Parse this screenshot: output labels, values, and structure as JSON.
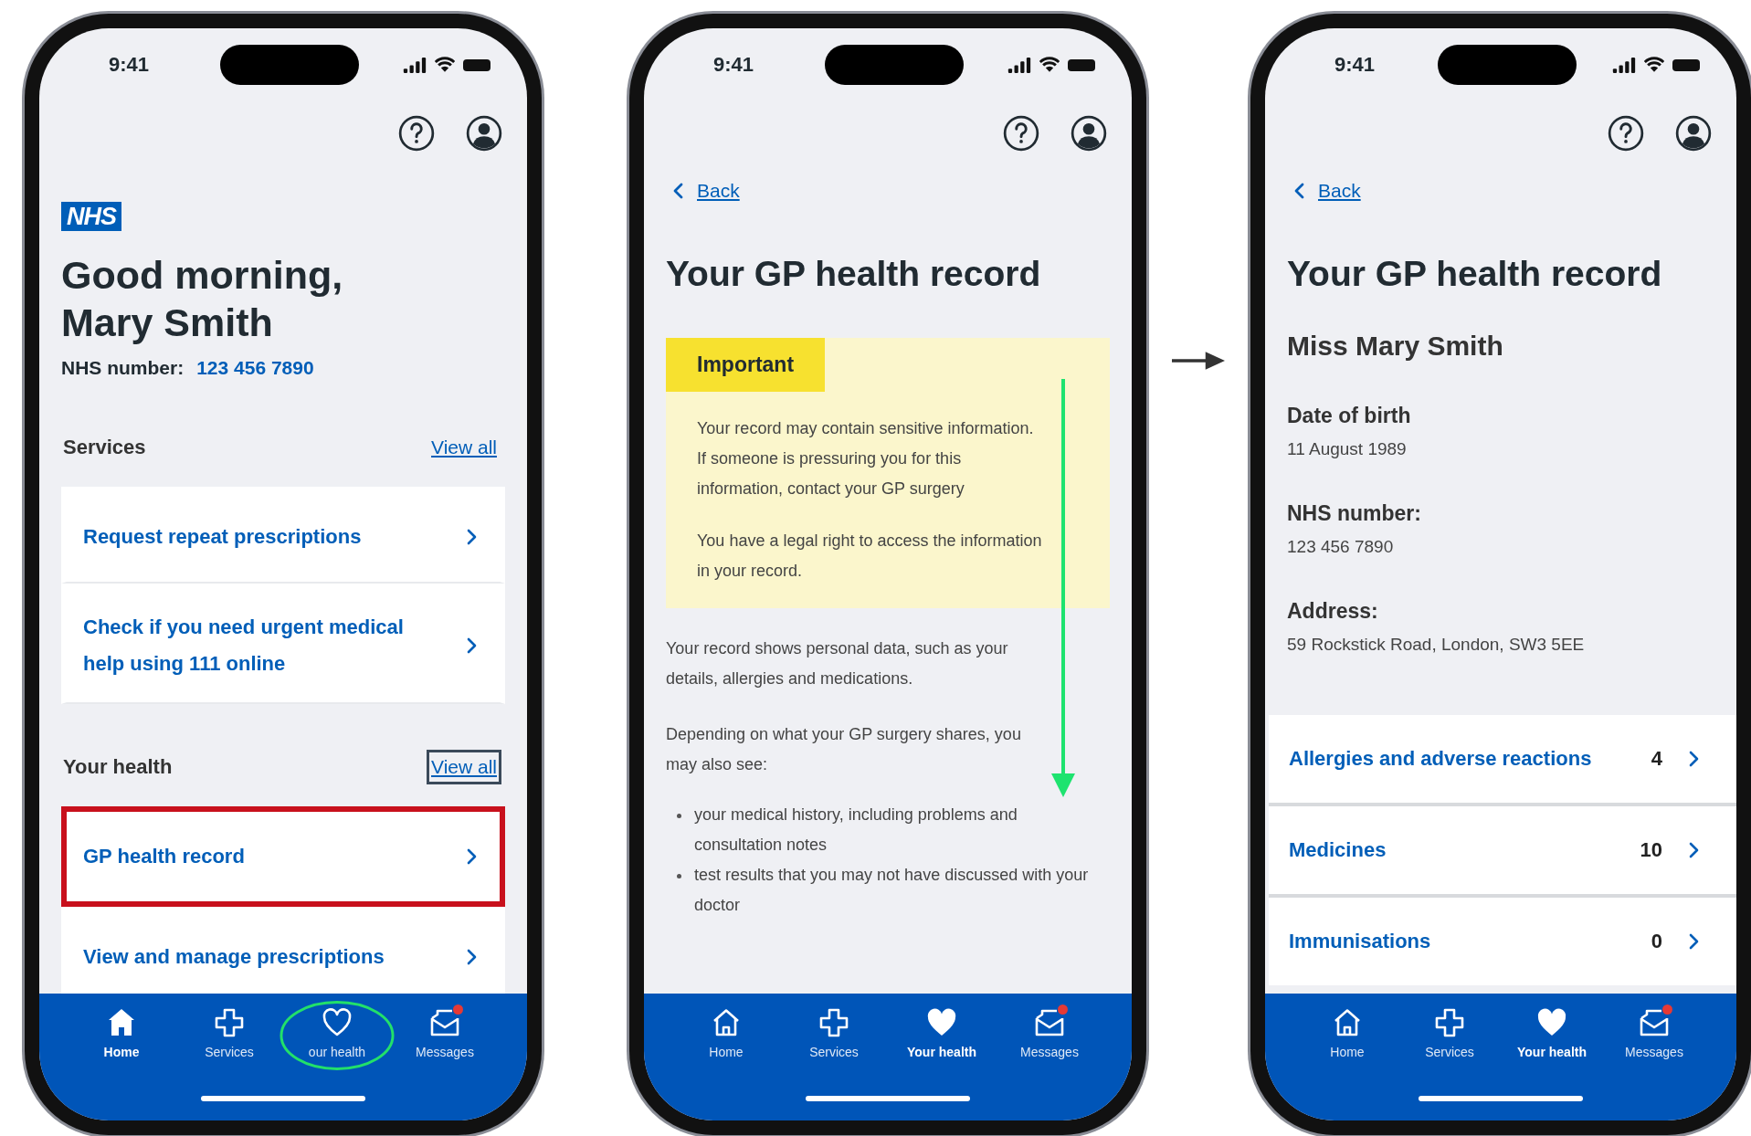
{
  "screens": [
    {
      "kind": "home",
      "time": "9:41",
      "logo": "NHS",
      "greeting": "Good morning, Mary Smith",
      "nhs_number_label": "NHS number:",
      "nhs_number": "123 456 7890",
      "sections": [
        {
          "title": "Services",
          "link": {
            "label": "View all",
            "boxed": false
          },
          "items": [
            {
              "label": "Request repeat prescriptions",
              "highlighted": false
            },
            {
              "label": "Check if you need urgent medical help using 111 online",
              "highlighted": false
            }
          ]
        },
        {
          "title": "Your health",
          "link": {
            "label": "View all",
            "boxed": true
          },
          "items": [
            {
              "label": "GP health record",
              "highlighted": true
            },
            {
              "label": "View and manage prescriptions",
              "highlighted": false
            }
          ]
        }
      ],
      "tabs": [
        {
          "label": "Home",
          "selected": true,
          "circled": false,
          "unread": false
        },
        {
          "label": "Services",
          "selected": false,
          "circled": false,
          "unread": false
        },
        {
          "label": "our health",
          "selected": false,
          "circled": true,
          "unread": false
        },
        {
          "label": "Messages",
          "selected": false,
          "circled": false,
          "unread": true
        }
      ],
      "scroll_arrow": false,
      "arrow_to_next": false
    },
    {
      "kind": "info",
      "time": "9:41",
      "back": "Back",
      "title": "Your GP health record",
      "callout": {
        "label": "Important",
        "paragraphs": [
          "Your record may contain sensitive information. If someone is pressuring you for this information, contact your GP surgery",
          "You have a legal right to access the information in your record."
        ]
      },
      "paragraphs": [
        "Your record shows personal data, such as your details, allergies and medications.",
        "Depending on what your GP surgery shares, you may also see:"
      ],
      "bullets": [
        "your medical history, including problems and consultation notes",
        "test results that you may not have discussed with your doctor"
      ],
      "tabs": [
        {
          "label": "Home",
          "selected": false,
          "circled": false,
          "unread": false
        },
        {
          "label": "Services",
          "selected": false,
          "circled": false,
          "unread": false
        },
        {
          "label": "Your health",
          "selected": true,
          "circled": false,
          "unread": false
        },
        {
          "label": "Messages",
          "selected": false,
          "circled": false,
          "unread": true
        }
      ],
      "scroll_arrow": true,
      "arrow_to_next": true
    },
    {
      "kind": "record",
      "time": "9:41",
      "back": "Back",
      "title": "Your GP health record",
      "name": "Miss Mary Smith",
      "fields": [
        {
          "label": "Date of birth",
          "value": "11 August 1989"
        },
        {
          "label": "NHS number:",
          "value": "123 456 7890"
        },
        {
          "label": "Address:",
          "value": "59 Rockstick Road, London, SW3 5EE"
        }
      ],
      "rows": [
        {
          "label": "Allergies and adverse reactions",
          "count": "4"
        },
        {
          "label": "Medicines",
          "count": "10"
        },
        {
          "label": "Immunisations",
          "count": "0"
        }
      ],
      "tabs": [
        {
          "label": "Home",
          "selected": false,
          "circled": false,
          "unread": false
        },
        {
          "label": "Services",
          "selected": false,
          "circled": false,
          "unread": false
        },
        {
          "label": "Your health",
          "selected": true,
          "circled": false,
          "unread": false
        },
        {
          "label": "Messages",
          "selected": false,
          "circled": false,
          "unread": true
        }
      ],
      "scroll_arrow": false,
      "arrow_to_next": false
    }
  ]
}
